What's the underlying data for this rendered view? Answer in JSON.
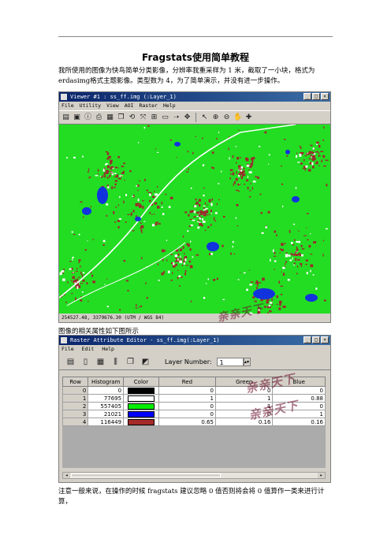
{
  "document": {
    "title": "Fragstats使用简单教程",
    "intro": "我所使用的图像为快鸟简单分类影像，分辨率我重采样为 1 米，截取了一小块，格式为erdasimg格式主题影像。类型数为 4，为了简单演示，并没有进一步操作。",
    "caption": "图像的相关属性如下图所示",
    "note": "注意一般来说，在操作的时候 fragstats 建议忽略 0 值否则将会将 0 值算作一类来进行计算，"
  },
  "viewer": {
    "title": "Viewer #1 : ss_ff.img (:Layer_1)",
    "menu": [
      "File",
      "Utility",
      "View",
      "AOI",
      "Raster",
      "Help"
    ],
    "status": "254527.48, 3379676.30      (UTM / WGS 84)",
    "toolbar_icons": [
      "open-icon",
      "open-layer-icon",
      "info-icon",
      "print-icon",
      "save-icon",
      "copy-icon",
      "rotate-icon",
      "fit-icon",
      "zoom-box-icon",
      "measure-icon",
      "arrow-icon",
      "pan-icon",
      "select-icon",
      "zoom-in-icon",
      "zoom-out-icon",
      "roam-icon",
      "inquire-icon"
    ],
    "colors": {
      "background": "#22dd22",
      "urban": "#9a2b2b",
      "water": "#1133dd",
      "road": "#ffffff"
    }
  },
  "editor": {
    "title": "Raster Attribute Editor - ss_ff.img(:Layer_1)",
    "menu": [
      "File",
      "Edit",
      "Help"
    ],
    "layer_label": "Layer Number:",
    "layer_value": "1",
    "columns": [
      "Row",
      "Histogram",
      "Color",
      "Red",
      "Green",
      "Blue"
    ],
    "rows": [
      {
        "row": "0",
        "histogram": "0",
        "color": "#000000",
        "red": "0",
        "green": "0",
        "blue": "0"
      },
      {
        "row": "1",
        "histogram": "77695",
        "color": "#ffffff",
        "red": "1",
        "green": "1",
        "blue": "0.88"
      },
      {
        "row": "2",
        "histogram": "557405",
        "color": "#00ee00",
        "red": "0",
        "green": "1",
        "blue": "0"
      },
      {
        "row": "3",
        "histogram": "21021",
        "color": "#0000ff",
        "red": "0",
        "green": "0",
        "blue": "1"
      },
      {
        "row": "4",
        "histogram": "116449",
        "color": "#a52a2a",
        "red": "0.65",
        "green": "0.16",
        "blue": "0.16"
      }
    ]
  },
  "watermark": "亲亲天下"
}
